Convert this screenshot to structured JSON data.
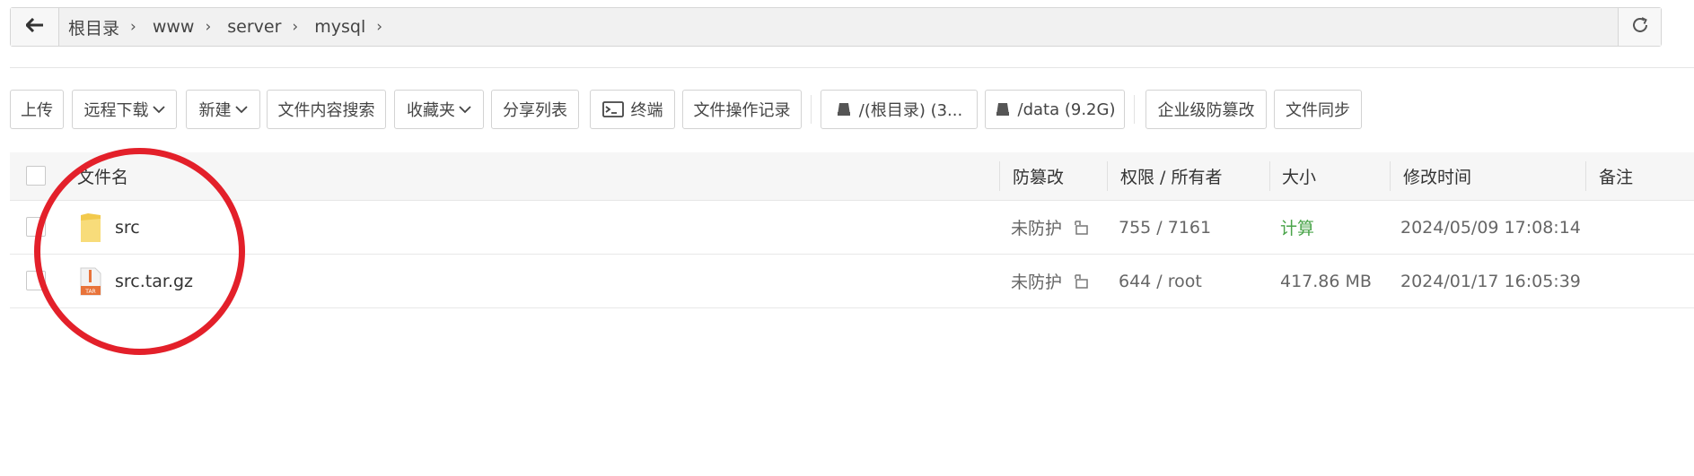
{
  "breadcrumb": {
    "items": [
      "根目录",
      "www",
      "server",
      "mysql"
    ]
  },
  "toolbar": {
    "upload": "上传",
    "remote_download": "远程下载",
    "new": "新建",
    "content_search": "文件内容搜索",
    "favorites": "收藏夹",
    "share_list": "分享列表",
    "terminal": "终端",
    "operation_log": "文件操作记录",
    "disk_root": "/(根目录) (3...",
    "disk_data": "/data (9.2G)",
    "tamper_proof": "企业级防篡改",
    "file_sync": "文件同步"
  },
  "table": {
    "headers": {
      "name": "文件名",
      "tamper": "防篡改",
      "perm_owner": "权限 / 所有者",
      "size": "大小",
      "mtime": "修改时间",
      "note": "备注"
    },
    "rows": [
      {
        "name": "src",
        "icon": "folder-icon",
        "tamper": "未防护",
        "perm": "755 / 7161",
        "size": "计算",
        "mtime": "2024/05/09 17:08:14",
        "note": ""
      },
      {
        "name": "src.tar.gz",
        "icon": "tar-archive-icon",
        "tamper": "未防护",
        "perm": "644 / root",
        "size": "417.86 MB",
        "mtime": "2024/01/17 16:05:39",
        "note": ""
      }
    ]
  },
  "colors": {
    "annotation_circle": "#e3202a",
    "calc_link": "#4aa44a",
    "folder": "#f5cf5a",
    "archive": "#e8733a"
  }
}
